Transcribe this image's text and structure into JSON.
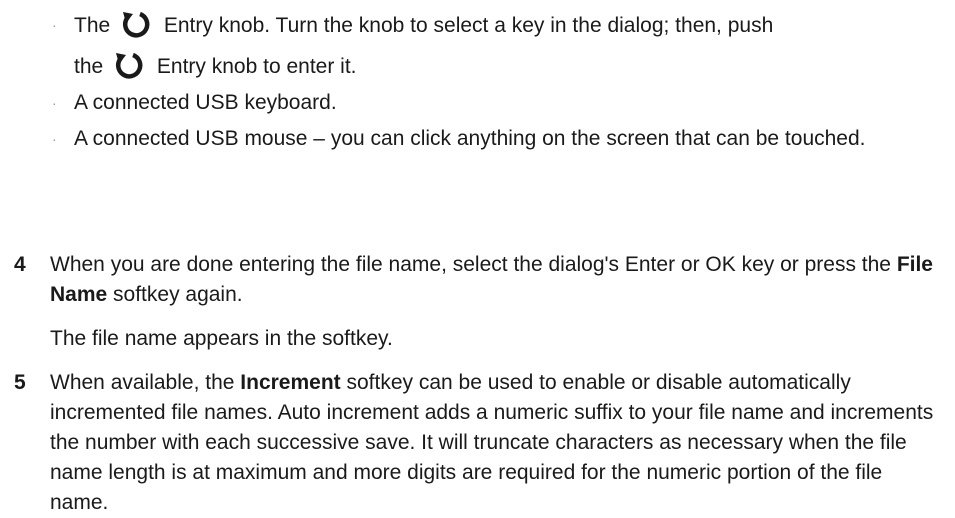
{
  "bullets": [
    {
      "part1": "The",
      "icon": "entry-knob-icon",
      "part2": "Entry knob. Turn the knob to select a key in the dialog; then, push",
      "part3": "the",
      "part4": "Entry knob to enter it."
    },
    {
      "text": "A connected USB keyboard."
    },
    {
      "text": "A connected USB mouse – you can click anything on the screen that can be touched."
    }
  ],
  "steps": [
    {
      "number": "4",
      "pre": "When you are done entering the file name, select the dialog's Enter or OK key or press the ",
      "bold": "File Name",
      "post": " softkey again.",
      "result": "The file name appears in the softkey."
    },
    {
      "number": "5",
      "pre": "When available, the ",
      "bold": "Increment",
      "post": " softkey can be used to enable or disable automatically incremented file names. Auto increment adds a numeric suffix to your file name and increments the number with each successive save. It will truncate characters as necessary when the file name length is at maximum and more digits are required for the numeric portion of the file name."
    }
  ],
  "bullet_glyph": "·",
  "colors": {
    "text": "#1a1a1a",
    "bullet": "#999999"
  }
}
